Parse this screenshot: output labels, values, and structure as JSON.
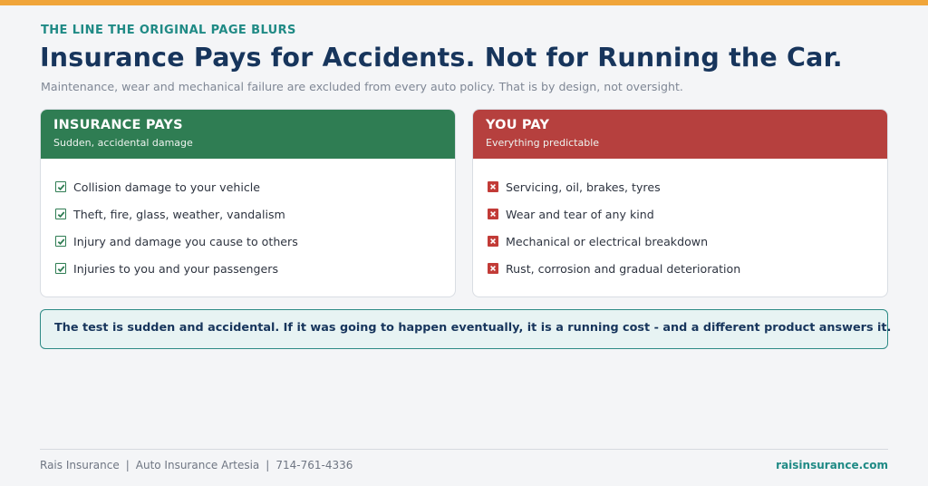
{
  "colors": {
    "accent_bar": "#f0a53a",
    "pays_header": "#2f7d53",
    "pays_icon": "#2f7d53",
    "you_header": "#b6403e",
    "you_icon": "#c23b37",
    "teal": "#1f8a85",
    "navy": "#17355c"
  },
  "header": {
    "eyebrow": "THE LINE THE ORIGINAL PAGE BLURS",
    "title": "Insurance Pays for Accidents. Not for Running the Car.",
    "subtitle": "Maintenance, wear and mechanical failure are excluded from every auto policy. That is by design, not oversight."
  },
  "insurance_pays": {
    "title": "INSURANCE PAYS",
    "subtitle": "Sudden, accidental damage",
    "icon": "checkbox-checked-icon",
    "items": [
      "Collision damage to your vehicle",
      "Theft, fire, glass, weather, vandalism",
      "Injury and damage you cause to others",
      "Injuries to you and your passengers"
    ]
  },
  "you_pay": {
    "title": "YOU PAY",
    "subtitle": "Everything predictable",
    "icon": "checkbox-crossed-icon",
    "items": [
      "Servicing, oil, brakes, tyres",
      "Wear and tear of any kind",
      "Mechanical or electrical breakdown",
      "Rust, corrosion and gradual deterioration"
    ]
  },
  "note": {
    "text": "The test is sudden and accidental. If it was going to happen eventually, it is a running cost - and a different product answers it."
  },
  "footer": {
    "company": "Rais Insurance",
    "service": "Auto Insurance Artesia",
    "phone": "714-761-4336",
    "separator": "|",
    "website": "raisinsurance.com"
  }
}
